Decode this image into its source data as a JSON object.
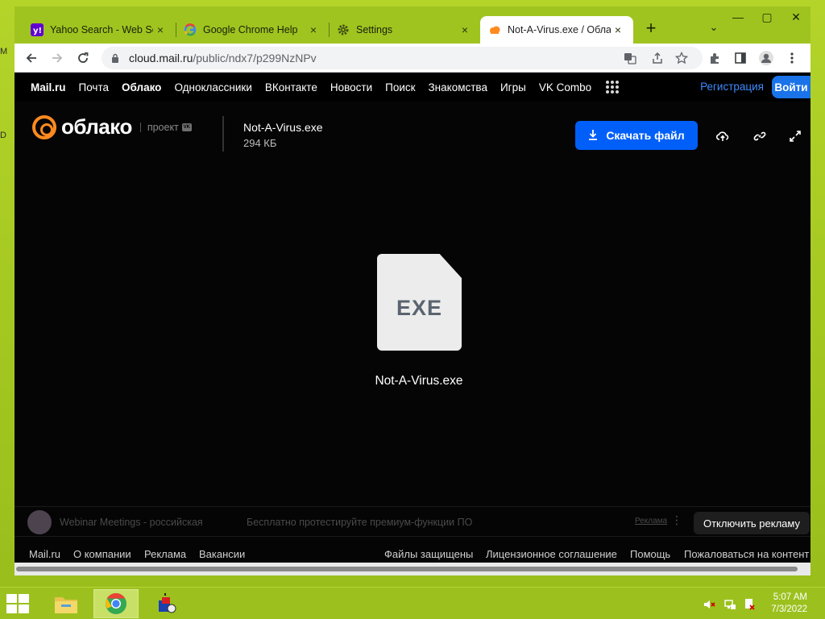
{
  "desktop": {
    "edge_letters": [
      "M",
      "D"
    ]
  },
  "browser": {
    "tabs": [
      {
        "title": "Yahoo Search - Web Search",
        "favicon": "yahoo-icon"
      },
      {
        "title": "Google Chrome Help",
        "favicon": "google-icon"
      },
      {
        "title": "Settings",
        "favicon": "gear-icon"
      },
      {
        "title": "Not-A-Virus.exe / Облако",
        "favicon": "cloud-icon",
        "active": true
      }
    ],
    "close_glyph": "×",
    "new_tab_glyph": "+",
    "tab_search_glyph": "⌄",
    "window_controls": {
      "minimize": "—",
      "maximize": "▢",
      "close": "✕"
    },
    "url": {
      "host": "cloud.mail.ru",
      "path": "/public/ndx7/p299NzNPv"
    }
  },
  "portal_nav": {
    "items": [
      "Mail.ru",
      "Почта",
      "Облако",
      "Одноклассники",
      "ВКонтакте",
      "Новости",
      "Поиск",
      "Знакомства",
      "Игры",
      "VK Combo"
    ],
    "register": "Регистрация",
    "login": "Войти"
  },
  "header": {
    "logo_text": "облако",
    "project": "проект",
    "project_badge": "VK",
    "file_name": "Not-A-Virus.exe",
    "file_size": "294 КБ",
    "download_label": "Скачать файл"
  },
  "preview": {
    "extension": "EXE",
    "file_name": "Not-A-Virus.exe"
  },
  "ad": {
    "text1": "Webinar Meetings - российская",
    "text2": "Бесплатно протестируйте премиум-функции ПО",
    "label": "Реклама",
    "disable": "Отключить рекламу"
  },
  "footer": {
    "left": [
      "Mail.ru",
      "О компании",
      "Реклама",
      "Вакансии"
    ],
    "right": [
      "Файлы защищены",
      "Лицензионное соглашение",
      "Помощь",
      "Пожаловаться на контент"
    ]
  },
  "taskbar": {
    "time": "5:07 AM",
    "date": "7/3/2022"
  },
  "colors": {
    "accent": "#005ff9",
    "brand_orange": "#ff8a1f",
    "desktop": "#a2c61f",
    "link_blue": "#3d8bff"
  }
}
